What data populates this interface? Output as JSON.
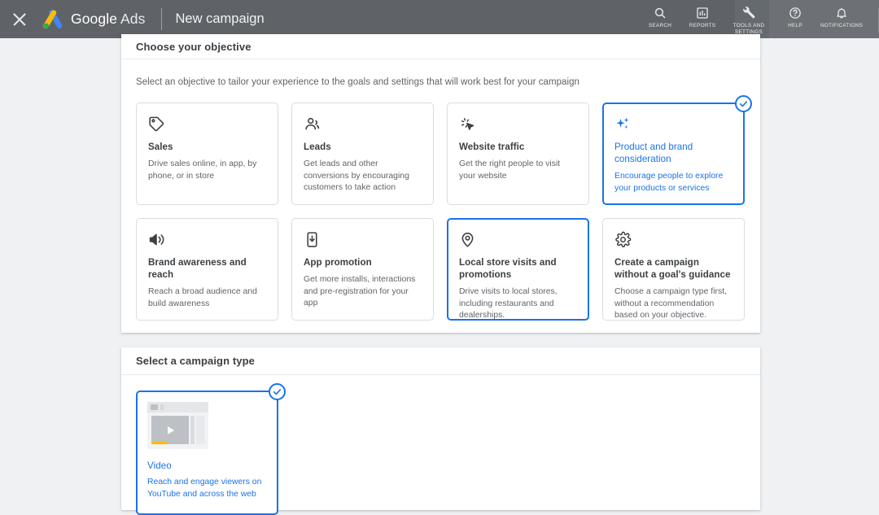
{
  "topbar": {
    "close_label": "Close",
    "brand_google": "Google",
    "brand_ads": "Ads",
    "page_title": "New campaign",
    "actions": [
      {
        "label": "SEARCH",
        "icon": "search-icon"
      },
      {
        "label": "REPORTS",
        "icon": "reports-icon"
      },
      {
        "label": "TOOLS AND\nSETTINGS",
        "icon": "tools-and-settings-icon"
      },
      {
        "label": "HELP",
        "icon": "help-icon"
      },
      {
        "label": "NOTIFICATIONS",
        "icon": "notifications-icon"
      }
    ]
  },
  "colors": {
    "accent_blue": "#1a73e8",
    "topbar_gray": "#5f6368",
    "page_bg": "#eff1f3",
    "card_border": "#dadce0",
    "text_primary": "#3c4043",
    "text_secondary": "#5f6368",
    "progress_yellow": "#fbbc04"
  },
  "objective_section": {
    "heading": "Choose your objective",
    "subtitle": "Select an objective to tailor your experience to the goals and settings that will work best for your campaign",
    "cards": [
      {
        "title": "Sales",
        "desc": "Drive sales online, in app, by phone, or in store",
        "icon": "tag-icon",
        "selected": false,
        "hovered": false
      },
      {
        "title": "Leads",
        "desc": "Get leads and other conversions by encouraging customers to take action",
        "icon": "people-icon",
        "selected": false,
        "hovered": false
      },
      {
        "title": "Website traffic",
        "desc": "Get the right people to visit your website",
        "icon": "cursor-click-icon",
        "selected": false,
        "hovered": false
      },
      {
        "title": "Product and brand consideration",
        "desc": "Encourage people to explore your products or services",
        "icon": "sparkle-icon",
        "selected": true,
        "hovered": false
      },
      {
        "title": "Brand awareness and reach",
        "desc": "Reach a broad audience and build awareness",
        "icon": "megaphone-icon",
        "selected": false,
        "hovered": false
      },
      {
        "title": "App promotion",
        "desc": "Get more installs, interactions and pre-registration for your app",
        "icon": "mobile-download-icon",
        "selected": false,
        "hovered": false
      },
      {
        "title": "Local store visits and promotions",
        "desc": "Drive visits to local stores, including restaurants and dealerships.",
        "icon": "location-pin-icon",
        "selected": false,
        "hovered": true
      },
      {
        "title": "Create a campaign without a goal's guidance",
        "desc": "Choose a campaign type first, without a recommendation based on your objective.",
        "icon": "gear-icon",
        "selected": false,
        "hovered": false
      }
    ]
  },
  "campaign_type_section": {
    "heading": "Select a campaign type",
    "cards": [
      {
        "title": "Video",
        "desc": "Reach and engage viewers on YouTube and across the web",
        "icon": "video-thumbnail-icon",
        "selected": true
      }
    ]
  }
}
